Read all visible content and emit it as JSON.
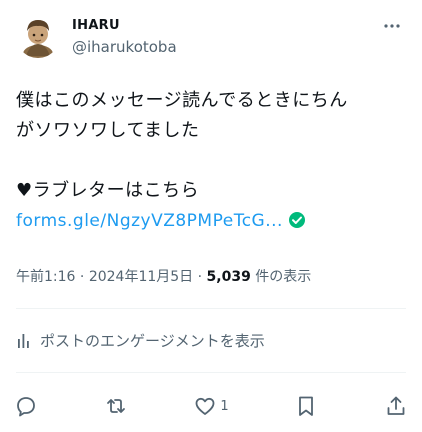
{
  "author": {
    "display_name": "IHARU",
    "handle": "@iharukotoba",
    "avatar_icon": "avatar-icon"
  },
  "tweet": {
    "line1": "僕はこのメッセージ読んでるときにちん",
    "line2": "がソワソワしてました",
    "line3": "♥ラブレターはこちら",
    "link_text": "forms.gle/NgzyVZ8PMPeTcG...",
    "link_badge_icon": "verified-badge-icon"
  },
  "meta": {
    "time": "午前1:16",
    "separator1": " · ",
    "date": "2024年11月5日",
    "separator2": " · ",
    "views": "5,039",
    "views_label": " 件の表示"
  },
  "engagement_link": "ポストのエンゲージメントを表示",
  "actions": {
    "reply_icon": "reply-icon",
    "repost_icon": "repost-icon",
    "like_icon": "like-icon",
    "like_count": "1",
    "bookmark_icon": "bookmark-icon",
    "share_icon": "share-icon"
  },
  "colors": {
    "text_primary": "#0f1419",
    "text_secondary": "#536471",
    "link": "#1d9bf0",
    "verified": "#00ba7c",
    "divider": "#eff3f4"
  }
}
